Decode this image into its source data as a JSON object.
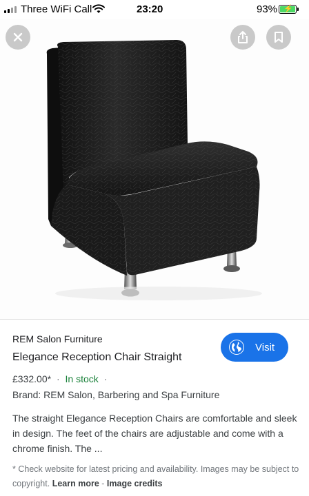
{
  "status_bar": {
    "carrier": "Three WiFi Call",
    "time": "23:20",
    "battery": "93%"
  },
  "image_viewer": {
    "image_alt": "Black crocodile-effect armless reception chair with chrome feet",
    "close_icon": "close-icon",
    "share_icon": "share-icon",
    "bookmark_icon": "bookmark-icon"
  },
  "product": {
    "source": "REM Salon Furniture",
    "title": "Elegance Reception Chair Straight",
    "price": "£332.00*",
    "separator": "·",
    "stock": "In stock",
    "brand": "Brand: REM Salon, Barbering and Spa Furniture",
    "description": "The straight Elegance Reception Chairs are comfortable and sleek in design. The feet of the chairs are adjustable and come with a chrome finish. The ..."
  },
  "visit_button": {
    "label": "Visit",
    "icon": "globe-icon",
    "color": "#1a73e8"
  },
  "footer": {
    "notice": "* Check website for latest pricing and availability. Images may be subject to copyright.",
    "learn_more": "Learn more",
    "separator": "-",
    "image_credits": "Image credits"
  },
  "colors": {
    "stock": "#188038",
    "accent": "#1a73e8"
  }
}
